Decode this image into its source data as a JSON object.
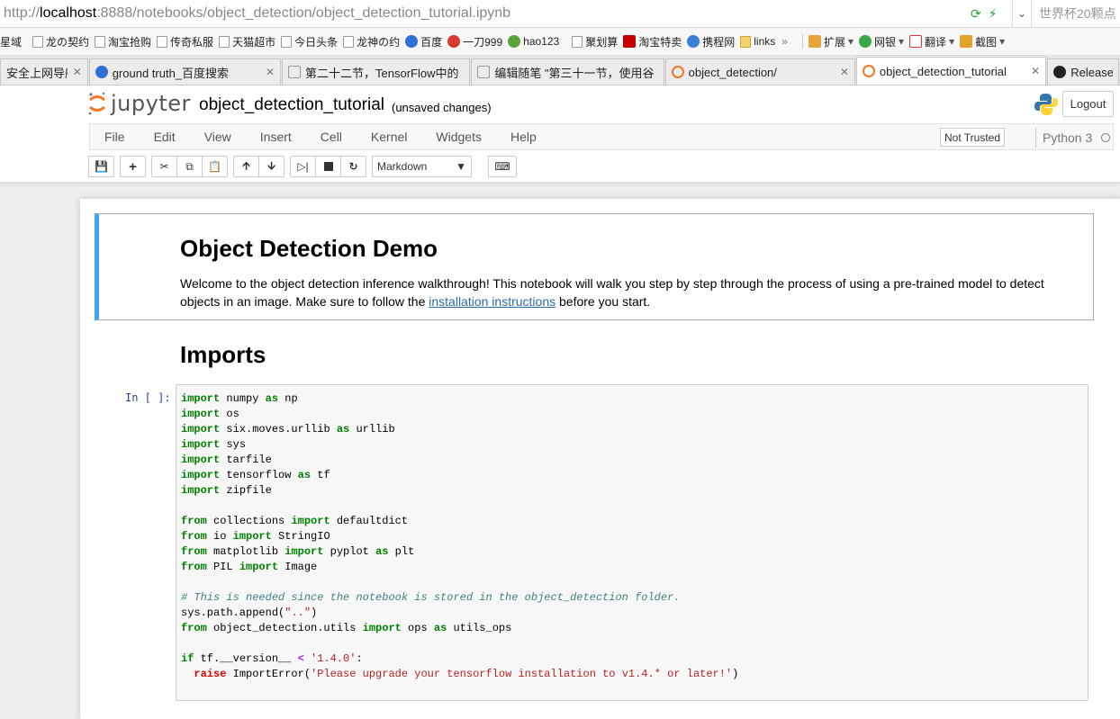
{
  "browser": {
    "url_prefix": "http://",
    "url_host": "localhost",
    "url_rest": ":8888/notebooks/object_detection/object_detection_tutorial.ipynb",
    "search_text": "世界杯20颗点",
    "bookmarks": [
      "星域",
      "龙の契约",
      "淘宝抢购",
      "传奇私服",
      "天猫超市",
      "今日头条",
      "龙神の约",
      "百度",
      "一刀999",
      "hao123",
      "聚划算",
      "淘宝特卖",
      "携程网",
      "links"
    ],
    "bookmarks_right": [
      "扩展",
      "网银",
      "翻译",
      "截图"
    ],
    "tabs": [
      {
        "title": "安全上网导航"
      },
      {
        "title": "ground truth_百度搜索"
      },
      {
        "title": "第二十二节，TensorFlow中的"
      },
      {
        "title": "编辑随笔 \"第三十一节，使用谷"
      },
      {
        "title": "object_detection/"
      },
      {
        "title": "object_detection_tutorial"
      },
      {
        "title": "Release"
      }
    ]
  },
  "jupyter": {
    "logo_text": "jupyter",
    "notebook_name": "object_detection_tutorial",
    "unsaved": "(unsaved changes)",
    "logout": "Logout",
    "menu": [
      "File",
      "Edit",
      "View",
      "Insert",
      "Cell",
      "Kernel",
      "Widgets",
      "Help"
    ],
    "not_trusted": "Not Trusted",
    "kernel": "Python 3",
    "cell_type": "Markdown"
  },
  "notebook": {
    "title": "Object Detection Demo",
    "intro_1": "Welcome to the object detection inference walkthrough! This notebook will walk you step by step through the process of using a pre-trained model to detect objects in an image. Make sure to follow the ",
    "intro_link": "installation instructions",
    "intro_2": " before you start.",
    "section": "Imports",
    "prompt": "In [ ]:"
  },
  "colors": {
    "selected_cell": "#42a5f5",
    "keyword": "#008000",
    "comment": "#408080",
    "string": "#ba2121",
    "prompt": "#303f9f"
  }
}
